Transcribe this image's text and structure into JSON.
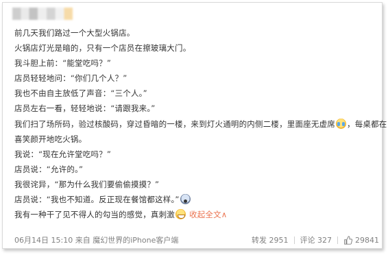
{
  "post": {
    "lines": [
      "前几天我们路过一个大型火锅店。",
      "火锅店灯光是暗的，只有一个店员在擦玻璃大门。",
      "我斗胆上前：“能堂吃吗？”",
      "店员轻轻地问：“你们几个人？”",
      "我也不由自主放低了声音：“三个人。”",
      "店员左右一看，轻轻地说：“请跟我来。”",
      "我们扫了场所码，验过核酸码，穿过昏暗的一楼，来到灯火通明的内侧二楼，里面座无虚席",
      "，每桌都在",
      "喜笑颜开地吃火锅。",
      "我说：“现在允许堂吃吗？”",
      "店员说：“允许的。”",
      "我很诧异，“那为什么我们要偷偷摸摸？”",
      "店员说：“我也不知道。反正现在餐馆都这样。”",
      "我有一种干了见不得人的勾当的感觉，真刺激"
    ],
    "emoji_cry": "crying-laughing-emoji",
    "emoji_shock": "shocked-emoji",
    "emoji_grin": "grinning-emoji",
    "collapse_label": "收起全文∧"
  },
  "footer": {
    "date": "06月14日 15:10",
    "source_prefix": "来自",
    "source": "魔幻世界的iPhone客户端",
    "repost_label": "转发 2951",
    "comment_label": "评论 327",
    "like_count": "29841",
    "like_icon": "thumbs-up-icon"
  },
  "colors": {
    "text": "#333333",
    "link": "#eb7350",
    "meta": "#808080"
  }
}
